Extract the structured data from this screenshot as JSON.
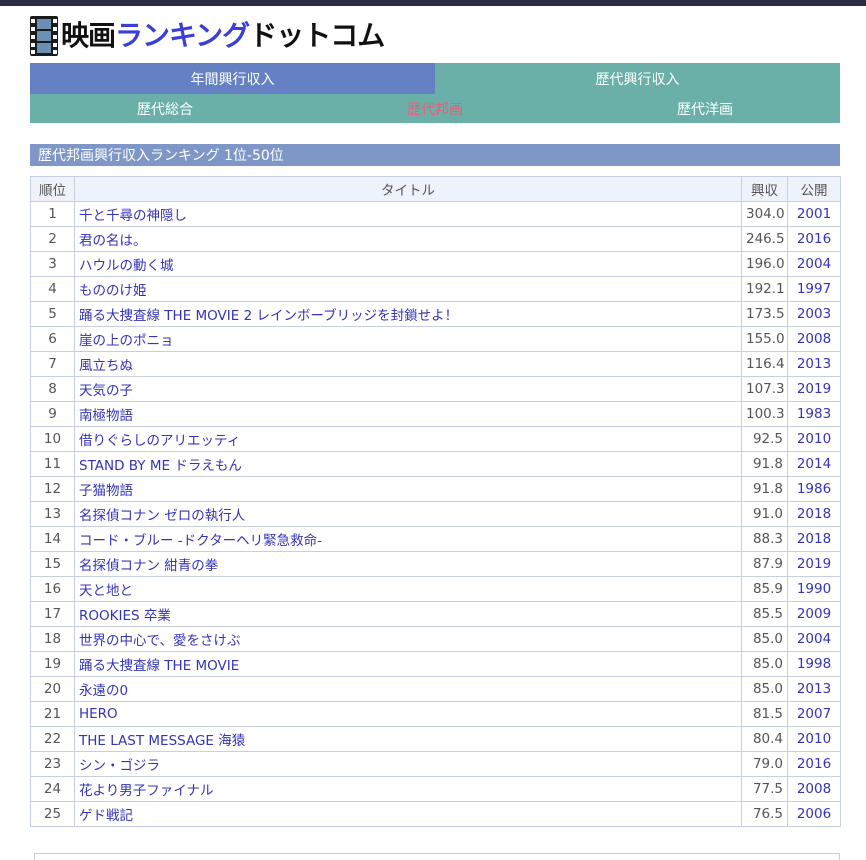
{
  "logo": {
    "part1": "映画",
    "part2": "ランキング",
    "part3": "ドットコム"
  },
  "tabs_primary": [
    {
      "label": "年間興行収入"
    },
    {
      "label": "歴代興行収入"
    }
  ],
  "tabs_secondary": [
    {
      "label": "歴代総合"
    },
    {
      "label": "歴代邦画",
      "active": true
    },
    {
      "label": "歴代洋画"
    }
  ],
  "section_title": "歴代邦画興行収入ランキング 1位-50位",
  "table": {
    "headers": {
      "rank": "順位",
      "title": "タイトル",
      "gross": "興収",
      "year": "公開"
    },
    "rows": [
      {
        "rank": "1",
        "title": "千と千尋の神隠し",
        "gross": "304.0",
        "year": "2001"
      },
      {
        "rank": "2",
        "title": "君の名は。",
        "gross": "246.5",
        "year": "2016"
      },
      {
        "rank": "3",
        "title": "ハウルの動く城",
        "gross": "196.0",
        "year": "2004"
      },
      {
        "rank": "4",
        "title": "もののけ姫",
        "gross": "192.1",
        "year": "1997"
      },
      {
        "rank": "5",
        "title": "踊る大捜査線 THE MOVIE 2 レインボーブリッジを封鎖せよ！",
        "gross": "173.5",
        "year": "2003"
      },
      {
        "rank": "6",
        "title": "崖の上のポニョ",
        "gross": "155.0",
        "year": "2008"
      },
      {
        "rank": "7",
        "title": "風立ちぬ",
        "gross": "116.4",
        "year": "2013"
      },
      {
        "rank": "8",
        "title": "天気の子",
        "gross": "107.3",
        "year": "2019"
      },
      {
        "rank": "9",
        "title": "南極物語",
        "gross": "100.3",
        "year": "1983"
      },
      {
        "rank": "10",
        "title": "借りぐらしのアリエッティ",
        "gross": "92.5",
        "year": "2010"
      },
      {
        "rank": "11",
        "title": "STAND BY ME ドラえもん",
        "gross": "91.8",
        "year": "2014"
      },
      {
        "rank": "12",
        "title": "子猫物語",
        "gross": "91.8",
        "year": "1986"
      },
      {
        "rank": "13",
        "title": "名探偵コナン ゼロの執行人",
        "gross": "91.0",
        "year": "2018"
      },
      {
        "rank": "14",
        "title": "コード・ブルー -ドクターヘリ緊急救命-",
        "gross": "88.3",
        "year": "2018"
      },
      {
        "rank": "15",
        "title": "名探偵コナン 紺青の拳",
        "gross": "87.9",
        "year": "2019"
      },
      {
        "rank": "16",
        "title": "天と地と",
        "gross": "85.9",
        "year": "1990"
      },
      {
        "rank": "17",
        "title": "ROOKIES 卒業",
        "gross": "85.5",
        "year": "2009"
      },
      {
        "rank": "18",
        "title": "世界の中心で、愛をさけぶ",
        "gross": "85.0",
        "year": "2004"
      },
      {
        "rank": "19",
        "title": "踊る大捜査線 THE MOVIE",
        "gross": "85.0",
        "year": "1998"
      },
      {
        "rank": "20",
        "title": "永遠の0",
        "gross": "85.0",
        "year": "2013"
      },
      {
        "rank": "21",
        "title": "HERO",
        "gross": "81.5",
        "year": "2007"
      },
      {
        "rank": "22",
        "title": "THE LAST MESSAGE 海猿",
        "gross": "80.4",
        "year": "2010"
      },
      {
        "rank": "23",
        "title": "シン・ゴジラ",
        "gross": "79.0",
        "year": "2016"
      },
      {
        "rank": "24",
        "title": "花より男子ファイナル",
        "gross": "77.5",
        "year": "2008"
      },
      {
        "rank": "25",
        "title": "ゲド戦記",
        "gross": "76.5",
        "year": "2006"
      }
    ]
  }
}
